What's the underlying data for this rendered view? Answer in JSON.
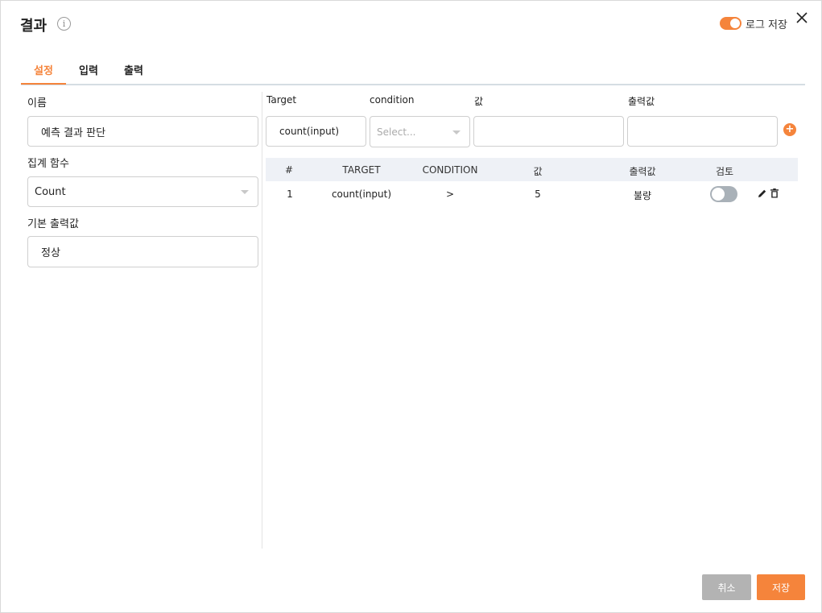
{
  "dialog": {
    "title": "결과",
    "info_icon": "info-icon",
    "log_save_label": "로그 저장",
    "log_save_enabled": true,
    "close_icon": "close-icon"
  },
  "tabs": [
    {
      "label": "설정",
      "active": true
    },
    {
      "label": "입력",
      "active": false
    },
    {
      "label": "출력",
      "active": false
    }
  ],
  "left_panel": {
    "name_label": "이름",
    "name_value": "예측 결과 판단",
    "aggregate_label": "집계 함수",
    "aggregate_value": "Count",
    "default_output_label": "기본 출력값",
    "default_output_value": "정상"
  },
  "rule_form": {
    "target_label": "Target",
    "target_value": "count(input)",
    "condition_label": "condition",
    "condition_placeholder": "Select...",
    "value_label": "값",
    "value_value": "",
    "output_label": "출력값",
    "output_value": "",
    "add_icon": "plus-icon"
  },
  "rule_table": {
    "headers": [
      "#",
      "TARGET",
      "CONDITION",
      "값",
      "출력값",
      "검토"
    ],
    "rows": [
      {
        "index": "1",
        "target": "count(input)",
        "condition": ">",
        "value": "5",
        "output": "불량",
        "review_enabled": false
      }
    ]
  },
  "footer": {
    "cancel_label": "취소",
    "save_label": "저장"
  },
  "colors": {
    "accent": "#f5843b",
    "cancel": "#b3b3b3",
    "table_header_bg": "#eef1f6"
  }
}
